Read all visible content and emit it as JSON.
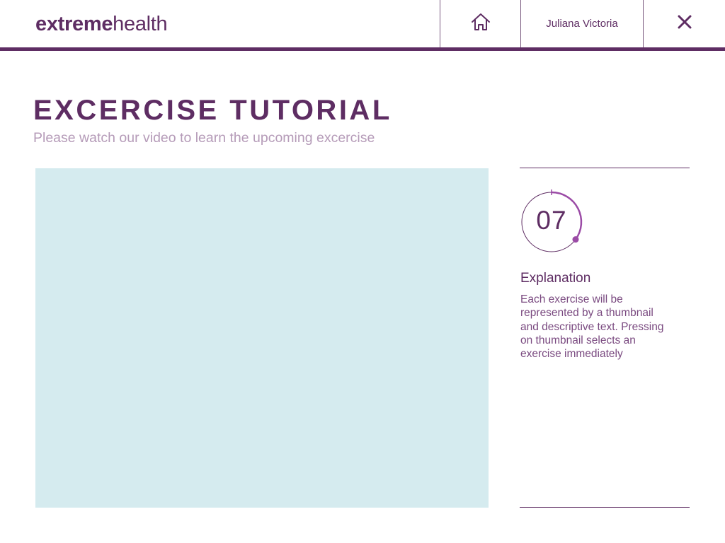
{
  "header": {
    "logo_bold": "extreme",
    "logo_light": "health",
    "user_name": "Juliana Victoria",
    "icons": {
      "home": "home-icon",
      "close": "close-icon"
    }
  },
  "page": {
    "title": "EXCERCISE TUTORIAL",
    "subtitle": "Please watch our video to learn the upcoming excercise"
  },
  "video": {
    "placeholder_color": "#d5ebef"
  },
  "timer": {
    "value": "07",
    "progress_fraction": 0.35
  },
  "explanation": {
    "title": "Explanation",
    "text": "Each exercise will be\nrepresented by a thumbnail\nand descriptive text. Pressing\non thumbnail selects an\nexercise  immediately"
  },
  "colors": {
    "brand": "#5e2d63",
    "accent": "#9b4ba6",
    "subtitle": "#b59bb8",
    "video_bg": "#d5ebef"
  }
}
